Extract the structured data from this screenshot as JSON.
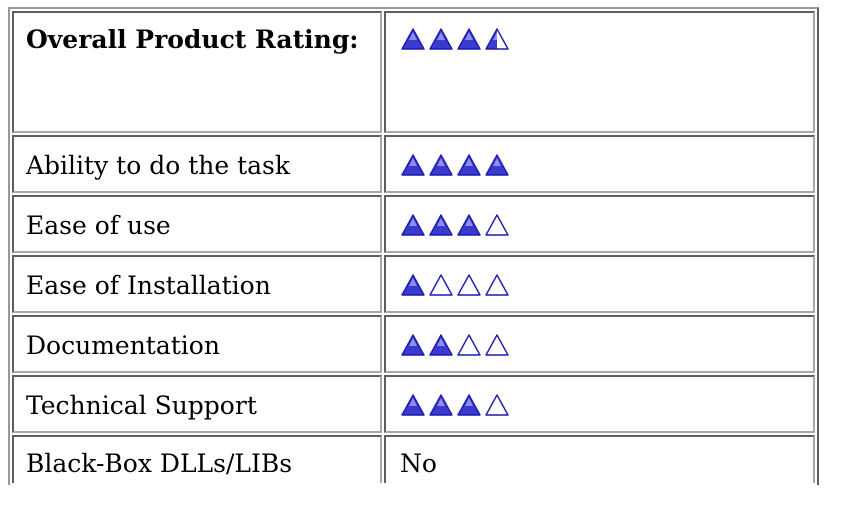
{
  "ratings": {
    "max": 4,
    "rows": [
      {
        "label": "Overall Product Rating:",
        "rating": 3.5,
        "is_heading": true
      },
      {
        "label": "Ability to do the task",
        "rating": 4
      },
      {
        "label": "Ease of use",
        "rating": 3
      },
      {
        "label": "Ease of Installation",
        "rating": 1
      },
      {
        "label": "Documentation",
        "rating": 2
      },
      {
        "label": "Technical Support",
        "rating": 3
      },
      {
        "label": "Black-Box DLLs/LIBs",
        "value": "No"
      }
    ]
  },
  "icon": {
    "name": "rating-triangle-icon",
    "fill_color": "#3a3acf",
    "highlight_color": "#8f8fea",
    "outline_color": "#1b1bb0"
  }
}
